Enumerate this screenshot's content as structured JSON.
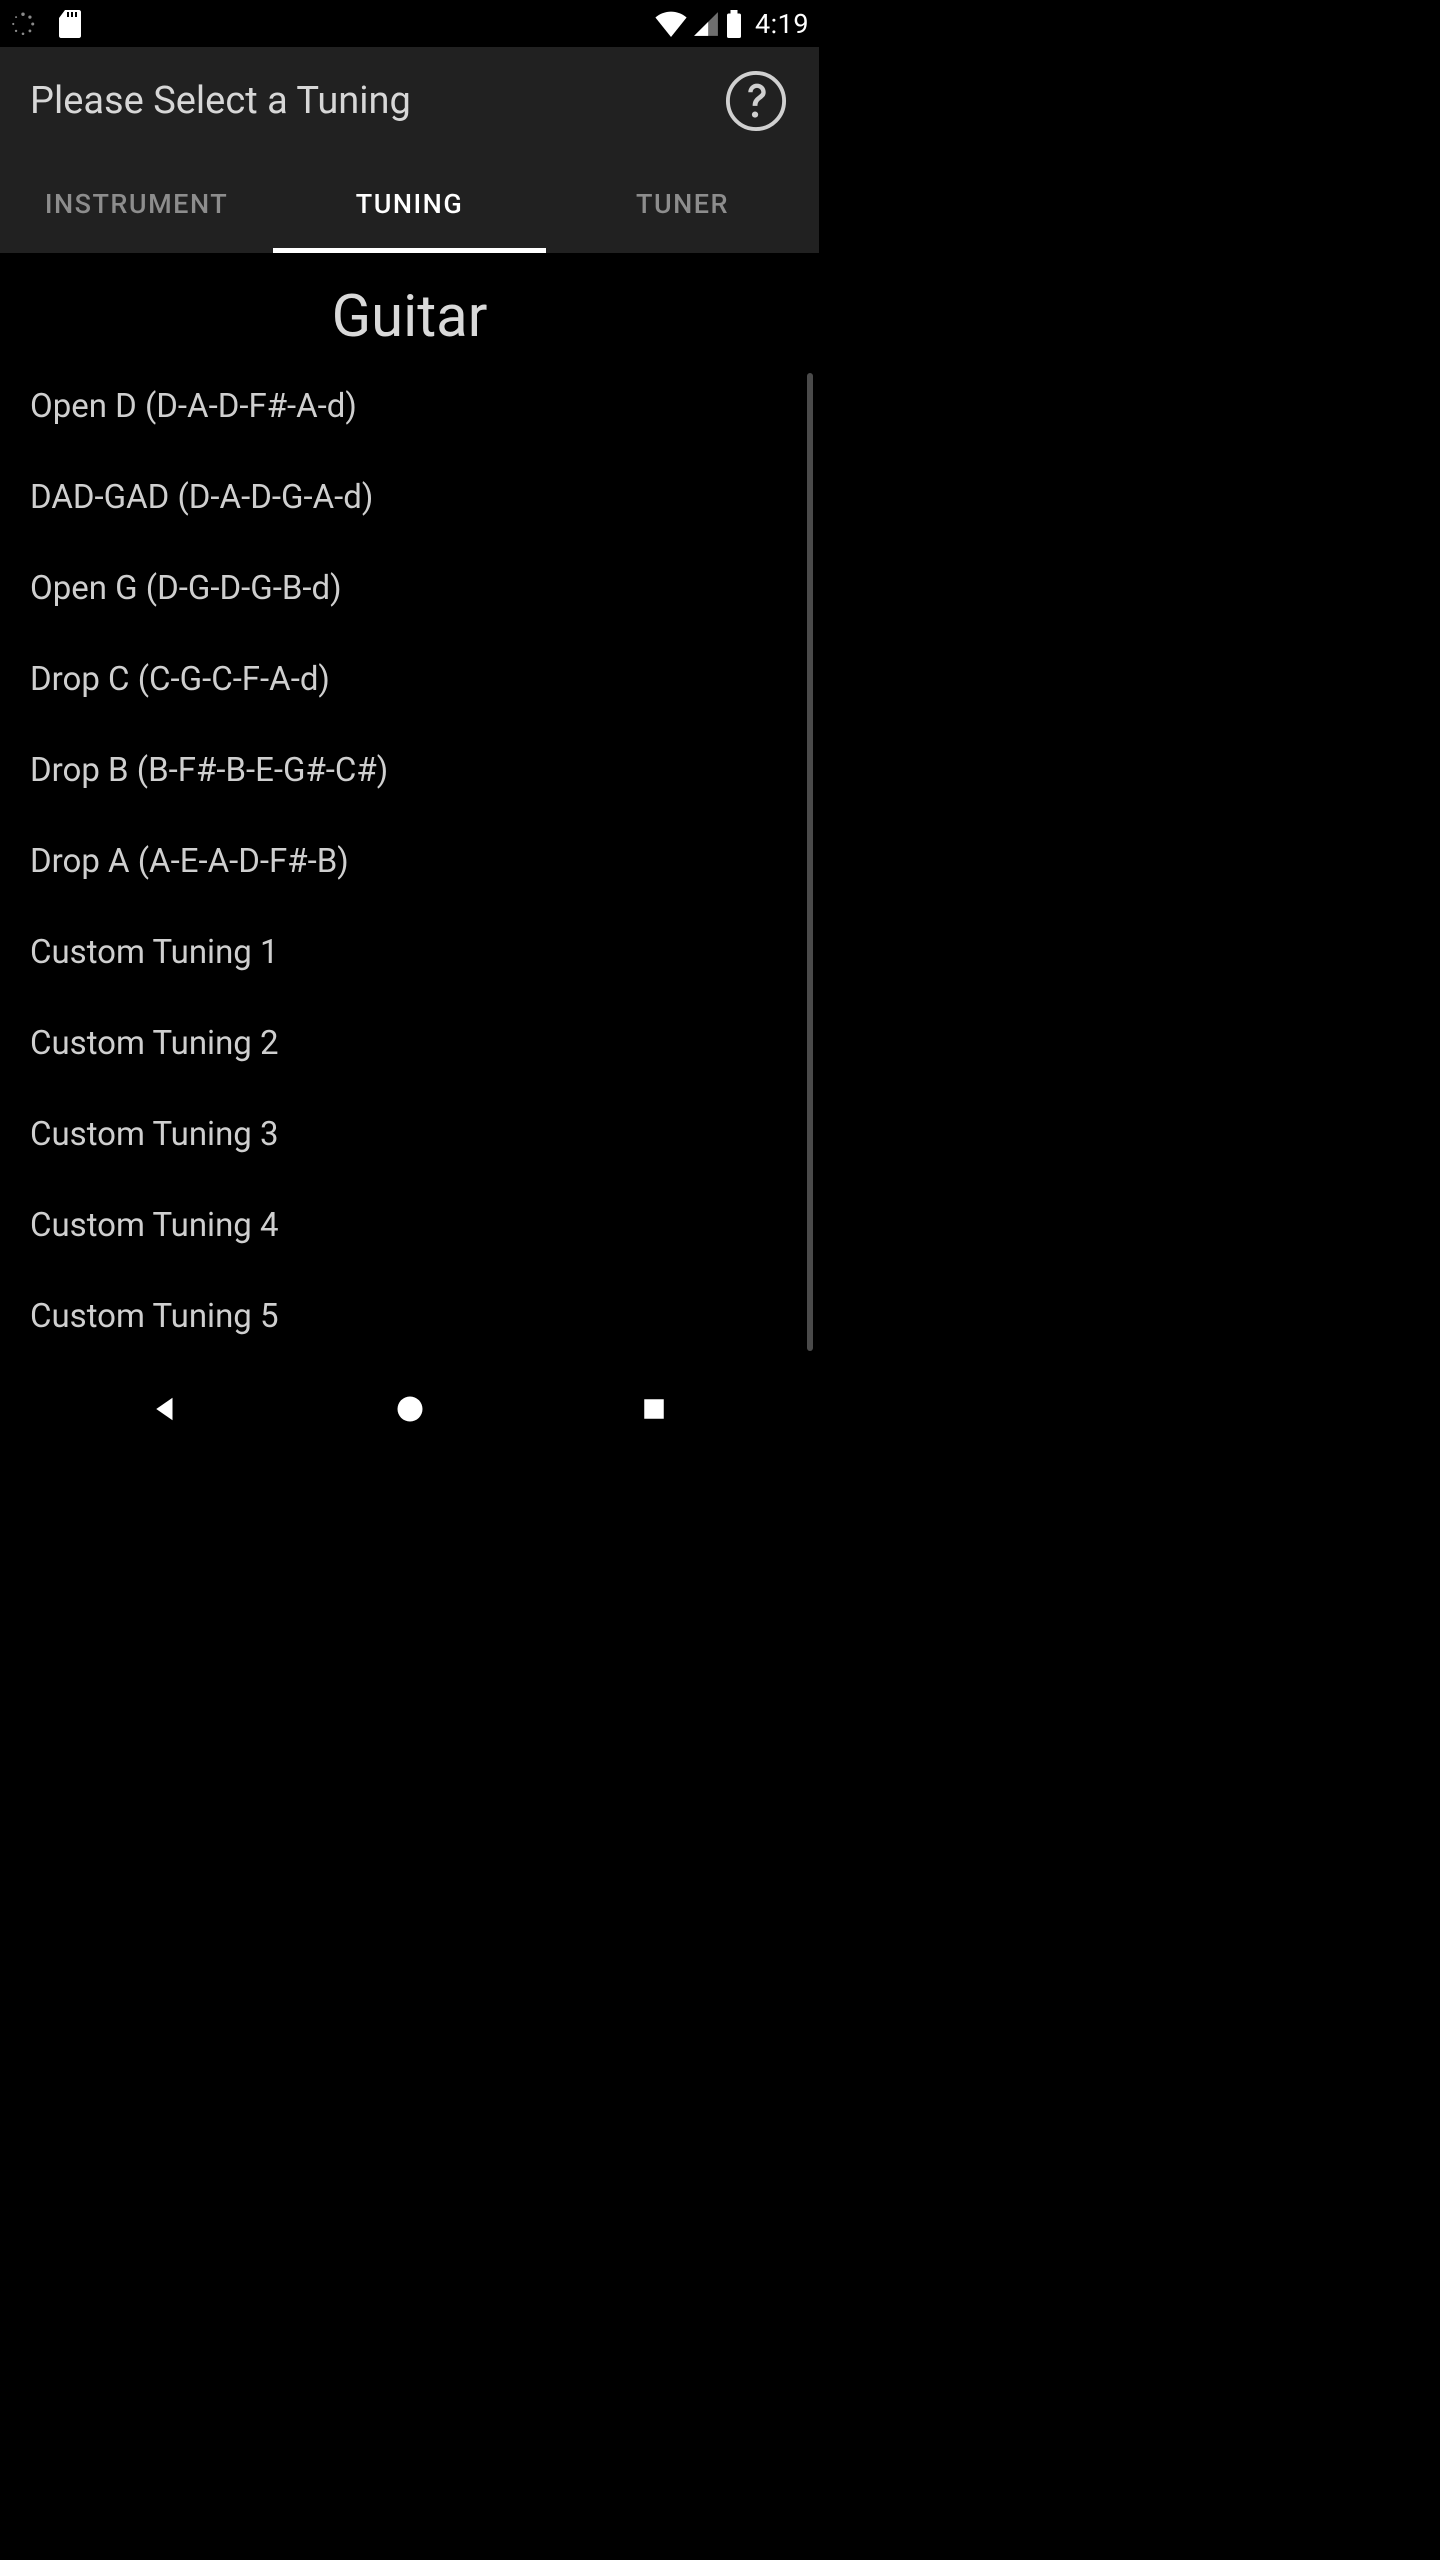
{
  "status_bar": {
    "clock": "4:19"
  },
  "header": {
    "title": "Please Select a Tuning"
  },
  "tabs": [
    {
      "label": "INSTRUMENT",
      "active": false
    },
    {
      "label": "TUNING",
      "active": true
    },
    {
      "label": "TUNER",
      "active": false
    }
  ],
  "section": {
    "heading": "Guitar"
  },
  "tunings": [
    "Open D (D-A-D-F#-A-d)",
    "DAD-GAD (D-A-D-G-A-d)",
    "Open G (D-G-D-G-B-d)",
    "Drop C (C-G-C-F-A-d)",
    "Drop B (B-F#-B-E-G#-C#)",
    "Drop A (A-E-A-D-F#-B)",
    "Custom Tuning 1",
    "Custom Tuning 2",
    "Custom Tuning 3",
    "Custom Tuning 4",
    "Custom Tuning 5"
  ]
}
